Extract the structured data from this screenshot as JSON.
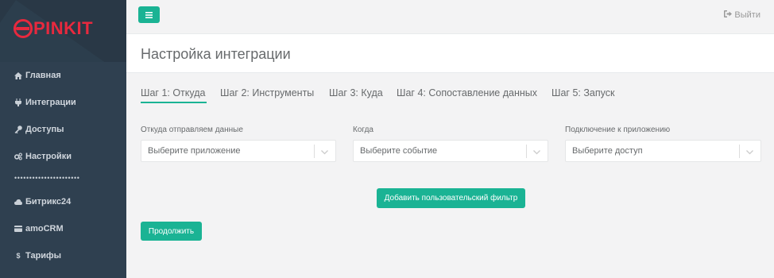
{
  "brand": {
    "logo_text": "PINKIT",
    "logo_color": "#e8293e"
  },
  "sidebar": {
    "items": [
      {
        "label": "Главная",
        "icon": "home-icon"
      },
      {
        "label": "Интеграции",
        "icon": "plug-icon"
      },
      {
        "label": "Доступы",
        "icon": "key-icon"
      },
      {
        "label": "Настройки",
        "icon": "gears-icon"
      },
      {
        "label": "Битрикс24",
        "icon": "cloud-icon"
      },
      {
        "label": "amoCRM",
        "icon": "card-icon"
      },
      {
        "label": "Тарифы",
        "icon": "dollar-icon"
      }
    ],
    "divider": "••••••••••••••••••••••"
  },
  "topbar": {
    "logout_label": "Выйти",
    "menu_icon": "hamburger-icon"
  },
  "page": {
    "title": "Настройка интеграции"
  },
  "steps": [
    {
      "label": "Шаг 1: Откуда",
      "active": true
    },
    {
      "label": "Шаг 2: Инструменты",
      "active": false
    },
    {
      "label": "Шаг 3: Куда",
      "active": false
    },
    {
      "label": "Шаг 4: Сопоставление данных",
      "active": false
    },
    {
      "label": "Шаг 5: Запуск",
      "active": false
    }
  ],
  "form": {
    "source": {
      "label": "Откуда отправляем данные",
      "value": "Выберите приложение"
    },
    "when": {
      "label": "Когда",
      "value": "Выберите событие"
    },
    "connection": {
      "label": "Подключение к приложению",
      "value": "Выберите доступ"
    }
  },
  "buttons": {
    "add_filter": "Добавить пользовательский фильтр",
    "continue": "Продолжить"
  },
  "colors": {
    "accent": "#1ab394",
    "sidebar": "#2f4050"
  }
}
